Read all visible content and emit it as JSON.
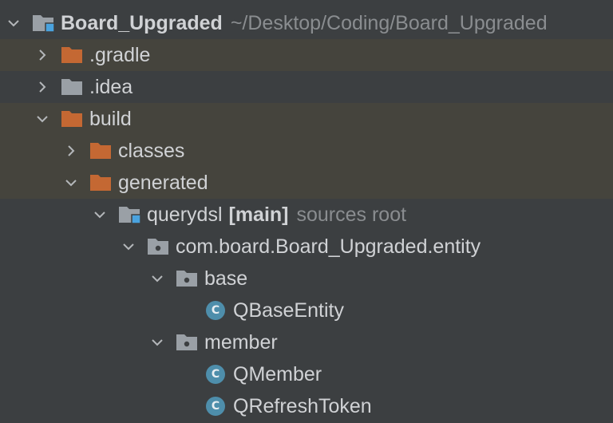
{
  "colors": {
    "background": "#3c3f41",
    "excluded_row": "#45443d",
    "excluded_folder": "#c46833",
    "plain_folder": "#9aa0a6",
    "source_root_badge": "#4aa3df",
    "class_icon": "#4e8eab"
  },
  "tree": [
    {
      "label": "Board_Upgraded",
      "extra": "~/Desktop/Coding/Board_Upgraded",
      "bold": true,
      "icon": "module-folder-icon",
      "expanded": true
    },
    {
      "label": ".gradle",
      "icon": "excluded-folder-icon",
      "expanded": false,
      "excluded": true
    },
    {
      "label": ".idea",
      "icon": "folder-icon",
      "expanded": false
    },
    {
      "label": "build",
      "icon": "excluded-folder-icon",
      "expanded": true,
      "excluded": true
    },
    {
      "label": "classes",
      "icon": "excluded-folder-icon",
      "expanded": false,
      "excluded": true
    },
    {
      "label": "generated",
      "icon": "excluded-folder-icon",
      "expanded": true,
      "excluded": true
    },
    {
      "label": "querydsl",
      "bracket": "[main]",
      "extra": "sources root",
      "icon": "source-root-folder-icon",
      "expanded": true
    },
    {
      "label": "com.board.Board_Upgraded.entity",
      "icon": "package-icon",
      "expanded": true
    },
    {
      "label": "base",
      "icon": "package-icon",
      "expanded": true
    },
    {
      "label": "QBaseEntity",
      "icon": "class-icon",
      "class_letter": "C"
    },
    {
      "label": "member",
      "icon": "package-icon",
      "expanded": true
    },
    {
      "label": "QMember",
      "icon": "class-icon",
      "class_letter": "C"
    },
    {
      "label": "QRefreshToken",
      "icon": "class-icon",
      "class_letter": "C"
    }
  ]
}
